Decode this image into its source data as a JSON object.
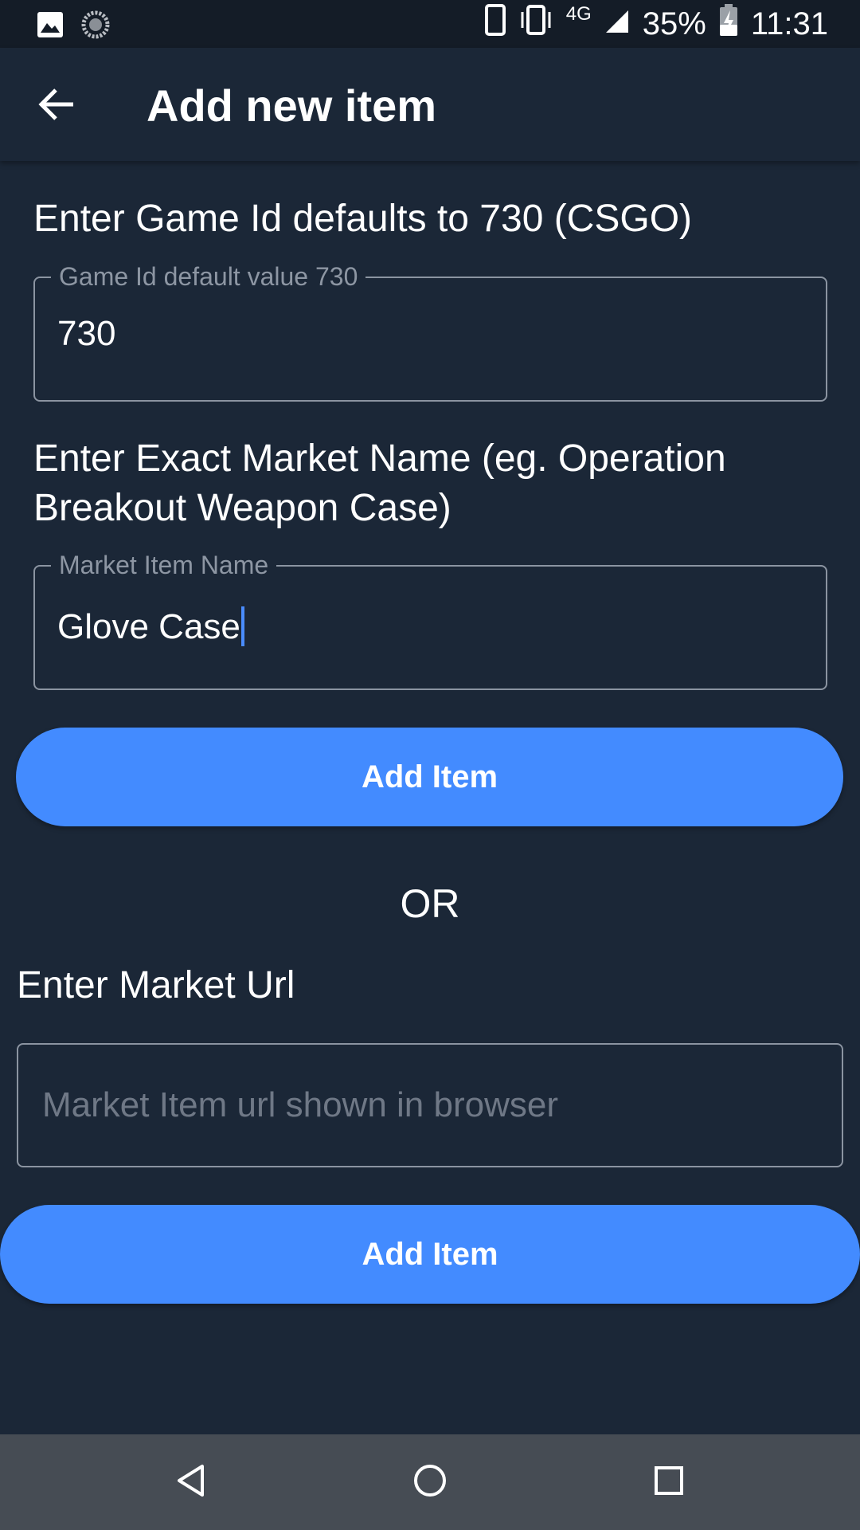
{
  "status_bar": {
    "network": "4G",
    "battery_percent": "35%",
    "time": "11:31",
    "icons": [
      "image-icon",
      "sync-icon",
      "phone-icon",
      "vibrate-icon",
      "signal-icon",
      "battery-charging-icon"
    ]
  },
  "app_bar": {
    "title": "Add new item",
    "back_icon": "arrow-back-icon"
  },
  "game_id_section": {
    "label": "Enter Game Id defaults to 730 (CSGO)",
    "field_label": "Game Id default value 730",
    "field_value": "730"
  },
  "market_name_section": {
    "label_line1": "Enter Exact Market Name (eg. Operation",
    "label_line2": "Breakout Weapon Case)",
    "field_label": "Market Item Name",
    "field_value": "Glove Case"
  },
  "add_button_1": {
    "label": "Add Item"
  },
  "separator": {
    "text": "OR"
  },
  "market_url_section": {
    "label": "Enter Market Url",
    "placeholder": "Market Item url shown in browser",
    "value": ""
  },
  "add_button_2": {
    "label": "Add Item"
  },
  "nav_bar": {
    "buttons": [
      "back-triangle-icon",
      "home-circle-icon",
      "recents-square-icon"
    ]
  },
  "colors": {
    "background": "#1b2737",
    "accent": "#438bff",
    "status_bar": "#141c27",
    "nav_bar": "#464c54"
  }
}
